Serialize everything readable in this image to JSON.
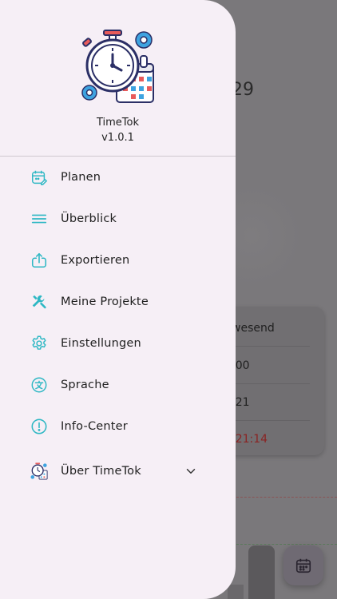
{
  "drawer": {
    "app_name": "TimeTok",
    "app_version": "v1.0.1",
    "items": [
      {
        "label": "Planen",
        "icon": "calendar-edit-icon"
      },
      {
        "label": "Überblick",
        "icon": "menu-lines-icon"
      },
      {
        "label": "Exportieren",
        "icon": "upload-icon"
      },
      {
        "label": "Meine Projekte",
        "icon": "tools-icon"
      },
      {
        "label": "Einstellungen",
        "icon": "gear-icon"
      },
      {
        "label": "Sprache",
        "icon": "translate-icon"
      },
      {
        "label": "Info-Center",
        "icon": "info-icon"
      },
      {
        "label": "Über TimeTok",
        "icon": "app-logo-icon"
      }
    ],
    "accent_color": "#2fb8c4"
  },
  "background": {
    "number_fragment": "29",
    "card_rows": [
      "wesend",
      ":00",
      ":21",
      ":21:14"
    ],
    "overtime_color": "#8a2323"
  }
}
